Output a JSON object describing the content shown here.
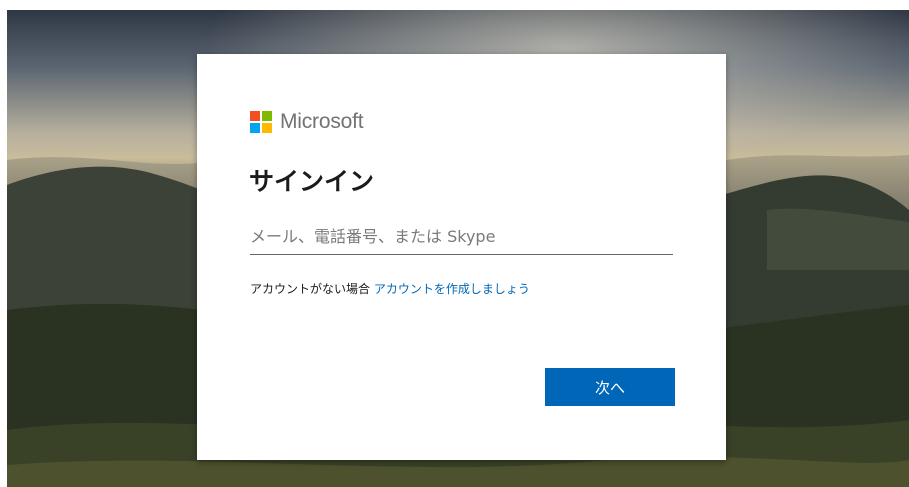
{
  "background": {
    "description_icon": "mountain-landscape-image"
  },
  "brand": {
    "name": "Microsoft",
    "colors": {
      "red": "#f25022",
      "green": "#7fba00",
      "blue": "#00a4ef",
      "yellow": "#ffb900"
    }
  },
  "signin": {
    "title": "サインイン",
    "email_placeholder": "メール、電話番号、または Skype",
    "no_account_text": "アカウントがない場合",
    "create_account_link": "アカウントを作成しましょう",
    "next_label": "次へ"
  },
  "accent_color": "#0067b8"
}
